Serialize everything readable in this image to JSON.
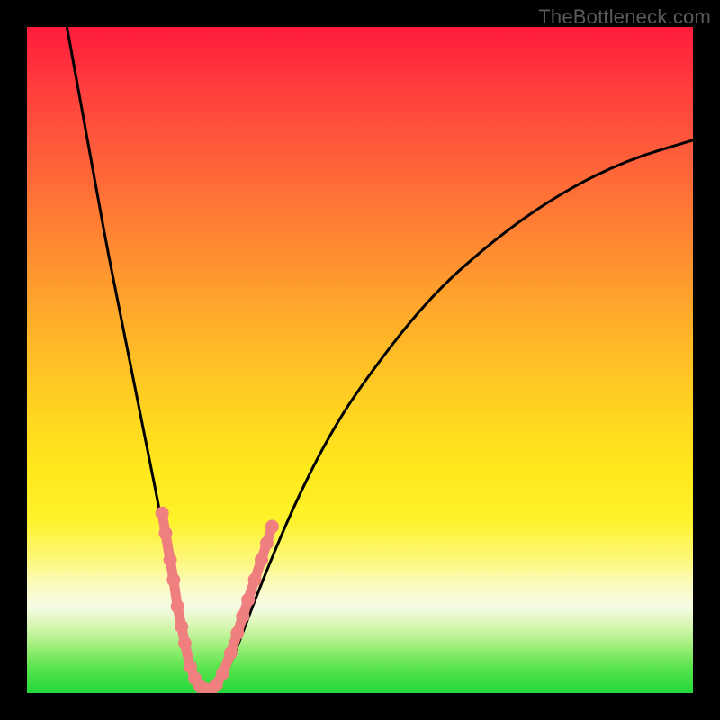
{
  "watermark": "TheBottleneck.com",
  "chart_data": {
    "type": "line",
    "title": "",
    "xlabel": "",
    "ylabel": "",
    "x_range": [
      0,
      100
    ],
    "y_range": [
      0,
      100
    ],
    "note": "V-shaped bottleneck curve over a red→green vertical gradient. Axes are unlabeled in the source image; x/y values are inferred from pixel positions on a 0–100 scale.",
    "series": [
      {
        "name": "bottleneck-curve",
        "x": [
          6,
          8,
          10,
          12,
          14,
          16,
          18,
          20,
          21,
          22,
          23,
          24,
          25,
          26,
          27,
          28,
          30,
          32,
          35,
          40,
          45,
          50,
          60,
          70,
          80,
          90,
          100
        ],
        "y": [
          100,
          89,
          78,
          67,
          57,
          47,
          37,
          27,
          21,
          16,
          11,
          6,
          3,
          1,
          0,
          0,
          3,
          8,
          16,
          28,
          38,
          46,
          59,
          68,
          75,
          80,
          83
        ]
      }
    ],
    "markers": {
      "name": "highlight-points",
      "note": "Salmon dot/segment markers clustered near the trough of the V.",
      "points": [
        {
          "x": 20.3,
          "y": 27.0
        },
        {
          "x": 20.8,
          "y": 24.0
        },
        {
          "x": 21.5,
          "y": 20.0
        },
        {
          "x": 22.0,
          "y": 17.0
        },
        {
          "x": 22.6,
          "y": 13.0
        },
        {
          "x": 23.2,
          "y": 10.0
        },
        {
          "x": 23.7,
          "y": 7.5
        },
        {
          "x": 24.5,
          "y": 4.0
        },
        {
          "x": 25.2,
          "y": 2.2
        },
        {
          "x": 26.0,
          "y": 1.0
        },
        {
          "x": 26.8,
          "y": 0.6
        },
        {
          "x": 27.6,
          "y": 0.5
        },
        {
          "x": 28.4,
          "y": 1.2
        },
        {
          "x": 29.4,
          "y": 3.0
        },
        {
          "x": 30.6,
          "y": 6.0
        },
        {
          "x": 31.6,
          "y": 9.0
        },
        {
          "x": 32.4,
          "y": 11.5
        },
        {
          "x": 33.2,
          "y": 14.0
        },
        {
          "x": 34.2,
          "y": 17.0
        },
        {
          "x": 35.2,
          "y": 20.0
        },
        {
          "x": 36.0,
          "y": 22.5
        },
        {
          "x": 36.8,
          "y": 25.0
        }
      ]
    },
    "gradient_stops": [
      {
        "pos": 0.0,
        "color": "#ff1a3c"
      },
      {
        "pos": 0.5,
        "color": "#ffd520"
      },
      {
        "pos": 0.87,
        "color": "#f6fbe6"
      },
      {
        "pos": 1.0,
        "color": "#22d83a"
      }
    ]
  }
}
